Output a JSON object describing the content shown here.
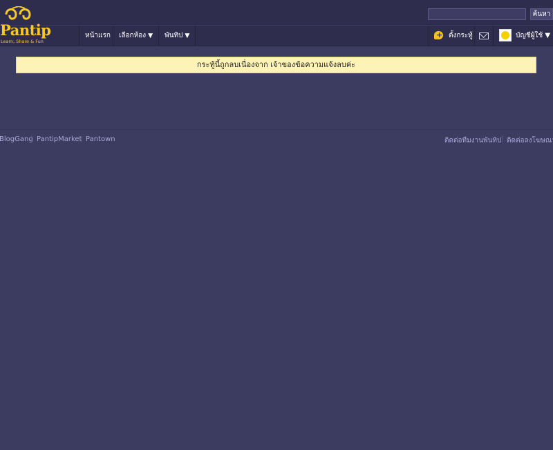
{
  "brand": {
    "name": "Pantip",
    "tagline": "Learn, Share & Fun",
    "accent": "#f7c828"
  },
  "search": {
    "placeholder": "",
    "button_label": "ค้นหา"
  },
  "nav": {
    "home": "หน้าแรก",
    "rooms": "เลือกห้อง",
    "pantip": "พันทิป",
    "caret": "▼",
    "post": "ตั้งกระทู้",
    "account": "บัญชีผู้ใช้"
  },
  "notice": {
    "message": "กระทู้นี้ถูกลบเนื่องจาก เจ้าของข้อความแจ้งลบค่ะ"
  },
  "footer": {
    "left_links": [
      "BlogGang",
      "PantipMarket",
      "Pantown"
    ],
    "right_links": [
      "ติดต่อทีมงานพันทิป",
      "ติดต่อลงโฆษณา"
    ],
    "separator": "|"
  },
  "colors": {
    "background": "#3c3b60",
    "header": "#2f2d4d",
    "notice_bg": "#fdf3b6",
    "link": "#a9a7d6"
  }
}
